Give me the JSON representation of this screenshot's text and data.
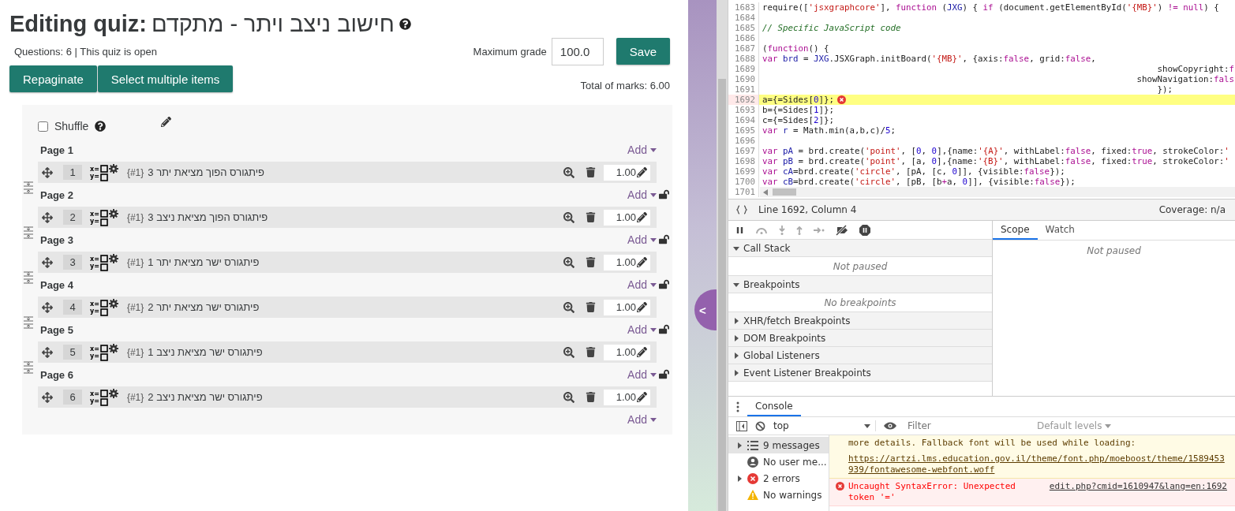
{
  "quiz": {
    "heading_label": "Editing quiz:",
    "title": "חישוב ניצב ויתר - מתקדם",
    "info": "Questions: 6 | This quiz is open",
    "max_grade_label": "Maximum grade",
    "max_grade_value": "100.0",
    "save_button": "Save",
    "buttons": [
      "Repaginate",
      "Select multiple items"
    ],
    "total_marks": "Total of marks: 6.00",
    "shuffle": {
      "label": "Shuffle",
      "checked": false
    },
    "pages": [
      {
        "title": "Page 1",
        "add": "Add",
        "question": {
          "number": "1",
          "icon_text": [
            "x=",
            "y="
          ],
          "tag": "{#1}",
          "name": "פיתגורס הפוך מציאת יתר 3",
          "mark": "1.00"
        }
      },
      {
        "title": "Page 2",
        "add": "Add",
        "question": {
          "number": "2",
          "icon_text": [
            "x=",
            "y="
          ],
          "tag": "{#1}",
          "name": "פיתגורס הפוך מציאת ניצב 3",
          "mark": "1.00"
        }
      },
      {
        "title": "Page 3",
        "add": "Add",
        "question": {
          "number": "3",
          "icon_text": [
            "x=",
            "y="
          ],
          "tag": "{#1}",
          "name": "פיתגורס ישר מציאת יתר 1",
          "mark": "1.00"
        }
      },
      {
        "title": "Page 4",
        "add": "Add",
        "question": {
          "number": "4",
          "icon_text": [
            "x=",
            "y="
          ],
          "tag": "{#1}",
          "name": "פיתגורס ישר מציאת יתר 2",
          "mark": "1.00"
        }
      },
      {
        "title": "Page 5",
        "add": "Add",
        "question": {
          "number": "5",
          "icon_text": [
            "x=",
            "y="
          ],
          "tag": "{#1}",
          "name": "פיתגורס ישר מציאת ניצב 1",
          "mark": "1.00"
        }
      },
      {
        "title": "Page 6",
        "add": "Add",
        "question": {
          "number": "6",
          "icon_text": [
            "x=",
            "y="
          ],
          "tag": "{#1}",
          "name": "פיתגורס ישר מציאת ניצב 2",
          "mark": "1.00"
        }
      }
    ],
    "final_add": "Add"
  },
  "side_toggle": {
    "label": "<"
  },
  "devtools": {
    "code_lines": [
      {
        "num": "1683",
        "error": false,
        "segments": [
          {
            "text": "require([",
            "kind": "plain"
          },
          {
            "text": "'jsxgraphcore'",
            "kind": "string"
          },
          {
            "text": "], ",
            "kind": "plain"
          },
          {
            "text": "function",
            "kind": "keyword"
          },
          {
            "text": " (",
            "kind": "plain"
          },
          {
            "text": "JXG",
            "kind": "variable"
          },
          {
            "text": ") { ",
            "kind": "plain"
          },
          {
            "text": "if",
            "kind": "keyword"
          },
          {
            "text": " (document.getElementById(",
            "kind": "plain"
          },
          {
            "text": "'{MB}'",
            "kind": "string"
          },
          {
            "text": ") ",
            "kind": "plain"
          },
          {
            "text": "!= null",
            "kind": "keyword"
          },
          {
            "text": ") {",
            "kind": "plain"
          }
        ]
      },
      {
        "num": "1684",
        "error": false
      },
      {
        "num": "1685",
        "error": false,
        "segments": [
          {
            "text": "// Specific JavaScript code",
            "kind": "comment"
          }
        ]
      },
      {
        "num": "1686",
        "error": false
      },
      {
        "num": "1687",
        "error": false,
        "segments": [
          {
            "text": "(",
            "kind": "plain"
          },
          {
            "text": "function",
            "kind": "keyword"
          },
          {
            "text": "() {",
            "kind": "plain"
          }
        ]
      },
      {
        "num": "1688",
        "error": false,
        "segments": [
          {
            "text": "var",
            "kind": "keyword"
          },
          {
            "text": " brd",
            "kind": "variable"
          },
          {
            "text": " = ",
            "kind": "plain"
          },
          {
            "text": "JXG",
            "kind": "variable"
          },
          {
            "text": ".JSXGraph.initBoard(",
            "kind": "plain"
          },
          {
            "text": "'{MB}'",
            "kind": "string"
          },
          {
            "text": ", {axis:",
            "kind": "plain"
          },
          {
            "text": "false",
            "kind": "keyword"
          },
          {
            "text": ", grid:",
            "kind": "plain"
          },
          {
            "text": "false",
            "kind": "keyword"
          },
          {
            "text": ",",
            "kind": "plain"
          }
        ]
      },
      {
        "num": "1689",
        "error": false,
        "segments": [
          {
            "text": "                                                                             showCopyright:",
            "kind": "plain"
          },
          {
            "text": "f",
            "kind": "keyword"
          }
        ]
      },
      {
        "num": "1690",
        "error": false,
        "segments": [
          {
            "text": "                                                                         showNavigation:",
            "kind": "plain"
          },
          {
            "text": "fals",
            "kind": "keyword"
          }
        ]
      },
      {
        "num": "1691",
        "error": false,
        "segments": [
          {
            "text": "                                                                             });",
            "kind": "plain"
          }
        ]
      },
      {
        "num": "1692",
        "error": true,
        "segments": [
          {
            "text": "a={=Sides[",
            "kind": "plain"
          },
          {
            "text": "0",
            "kind": "number"
          },
          {
            "text": "]};",
            "kind": "plain"
          }
        ]
      },
      {
        "num": "1693",
        "error": false,
        "segments": [
          {
            "text": "b={=Sides[",
            "kind": "plain"
          },
          {
            "text": "1",
            "kind": "number"
          },
          {
            "text": "]};",
            "kind": "plain"
          }
        ]
      },
      {
        "num": "1694",
        "error": false,
        "segments": [
          {
            "text": "c={=Sides[",
            "kind": "plain"
          },
          {
            "text": "2",
            "kind": "number"
          },
          {
            "text": "]};",
            "kind": "plain"
          }
        ]
      },
      {
        "num": "1695",
        "error": false,
        "segments": [
          {
            "text": "var",
            "kind": "keyword"
          },
          {
            "text": " r",
            "kind": "variable"
          },
          {
            "text": " = Math.min(a,b,c)/",
            "kind": "plain"
          },
          {
            "text": "5",
            "kind": "number"
          },
          {
            "text": ";",
            "kind": "plain"
          }
        ]
      },
      {
        "num": "1696",
        "error": false
      },
      {
        "num": "1697",
        "error": false,
        "segments": [
          {
            "text": "var",
            "kind": "keyword"
          },
          {
            "text": " pA",
            "kind": "variable"
          },
          {
            "text": " = brd.create(",
            "kind": "plain"
          },
          {
            "text": "'point'",
            "kind": "string"
          },
          {
            "text": ", [",
            "kind": "plain"
          },
          {
            "text": "0",
            "kind": "number"
          },
          {
            "text": ", ",
            "kind": "plain"
          },
          {
            "text": "0",
            "kind": "number"
          },
          {
            "text": "],{name:",
            "kind": "plain"
          },
          {
            "text": "'{A}'",
            "kind": "string"
          },
          {
            "text": ", withLabel:",
            "kind": "plain"
          },
          {
            "text": "false",
            "kind": "keyword"
          },
          {
            "text": ", fixed:",
            "kind": "plain"
          },
          {
            "text": "true",
            "kind": "keyword"
          },
          {
            "text": ", strokeColor:",
            "kind": "plain"
          },
          {
            "text": "'",
            "kind": "string"
          }
        ]
      },
      {
        "num": "1698",
        "error": false,
        "segments": [
          {
            "text": "var",
            "kind": "keyword"
          },
          {
            "text": " pB",
            "kind": "variable"
          },
          {
            "text": " = brd.create(",
            "kind": "plain"
          },
          {
            "text": "'point'",
            "kind": "string"
          },
          {
            "text": ", [a, ",
            "kind": "plain"
          },
          {
            "text": "0",
            "kind": "number"
          },
          {
            "text": "],{name:",
            "kind": "plain"
          },
          {
            "text": "'{B}'",
            "kind": "string"
          },
          {
            "text": ", withLabel:",
            "kind": "plain"
          },
          {
            "text": "false",
            "kind": "keyword"
          },
          {
            "text": ", fixed:",
            "kind": "plain"
          },
          {
            "text": "true",
            "kind": "keyword"
          },
          {
            "text": ", strokeColor:",
            "kind": "plain"
          },
          {
            "text": "'",
            "kind": "string"
          }
        ]
      },
      {
        "num": "1699",
        "error": false,
        "segments": [
          {
            "text": "var",
            "kind": "keyword"
          },
          {
            "text": " cA",
            "kind": "variable"
          },
          {
            "text": "=brd.create(",
            "kind": "plain"
          },
          {
            "text": "'circle'",
            "kind": "string"
          },
          {
            "text": ", [pA, [c, ",
            "kind": "plain"
          },
          {
            "text": "0",
            "kind": "number"
          },
          {
            "text": "]], {visible:",
            "kind": "plain"
          },
          {
            "text": "false",
            "kind": "keyword"
          },
          {
            "text": "});",
            "kind": "plain"
          }
        ]
      },
      {
        "num": "1700",
        "error": false,
        "segments": [
          {
            "text": "var",
            "kind": "keyword"
          },
          {
            "text": " cB",
            "kind": "variable"
          },
          {
            "text": "=brd.create(",
            "kind": "plain"
          },
          {
            "text": "'circle'",
            "kind": "string"
          },
          {
            "text": ", [pB, [b",
            "kind": "plain"
          },
          {
            "text": "+",
            "kind": "keyword"
          },
          {
            "text": "a, ",
            "kind": "plain"
          },
          {
            "text": "0",
            "kind": "number"
          },
          {
            "text": "]], {visible:",
            "kind": "plain"
          },
          {
            "text": "false",
            "kind": "keyword"
          },
          {
            "text": "});",
            "kind": "plain"
          }
        ]
      },
      {
        "num": "1701",
        "error": false
      }
    ],
    "status": {
      "position": "Line 1692, Column 4",
      "coverage": "Coverage: n/a"
    },
    "sections": [
      {
        "label": "Call Stack",
        "expanded": true,
        "message": "Not paused"
      },
      {
        "label": "Breakpoints",
        "expanded": true,
        "message": "No breakpoints"
      },
      {
        "label": "XHR/fetch Breakpoints",
        "expanded": false
      },
      {
        "label": "DOM Breakpoints",
        "expanded": false
      },
      {
        "label": "Global Listeners",
        "expanded": false
      },
      {
        "label": "Event Listener Breakpoints",
        "expanded": false
      }
    ],
    "side_tabs": [
      {
        "label": "Scope",
        "selected": true
      },
      {
        "label": "Watch",
        "selected": false
      }
    ],
    "side_message": "Not paused",
    "drawer_tabs": [
      {
        "label": "Console",
        "selected": true
      }
    ],
    "console_toolbar": {
      "context": "top",
      "filter_placeholder": "Filter",
      "levels": "Default levels"
    },
    "console_sidebar": [
      {
        "kind": "messages",
        "label": "9 messages",
        "selected": true,
        "expandable": true
      },
      {
        "kind": "user",
        "label": "No user me...",
        "selected": false,
        "expandable": false
      },
      {
        "kind": "errors",
        "label": "2 errors",
        "selected": false,
        "expandable": true
      },
      {
        "kind": "warnings",
        "label": "No warnings",
        "selected": false,
        "expandable": false
      }
    ],
    "messages": [
      {
        "kind": "warning",
        "text": "more details. Fallback font will be used while loading:",
        "link": "https://artzi.lms.education.gov.il/theme/font.php/moeboost/theme/1589453939/fontawesome-webfont.woff"
      },
      {
        "kind": "error",
        "text": "Uncaught SyntaxError: Unexpected token '='",
        "link": "edit.php?cmid=1610947&lang=en:1692"
      }
    ]
  }
}
